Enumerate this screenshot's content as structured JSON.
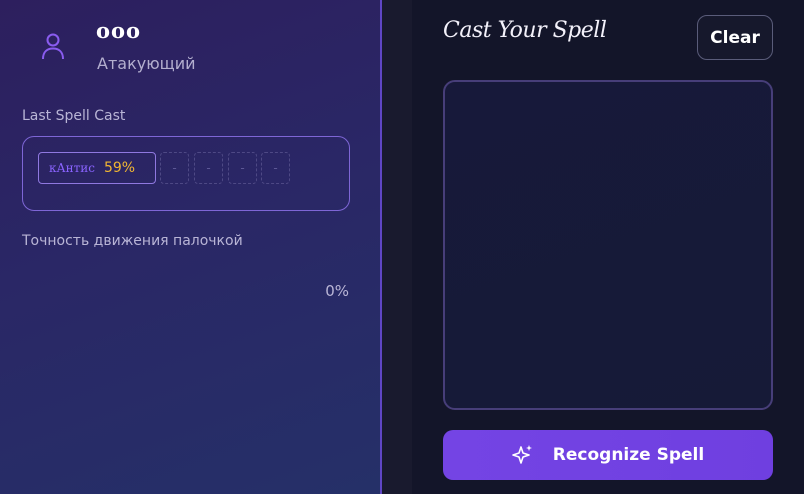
{
  "profile": {
    "name": "ooo",
    "role": "Атакующий",
    "icon": "user-icon"
  },
  "last_spell": {
    "label": "Last Spell Cast",
    "spell_name": "кАнтис",
    "confidence": "59%",
    "empty_slots": [
      "-",
      "-",
      "-",
      "-"
    ]
  },
  "accuracy": {
    "label": "Точность движения палочкой",
    "value": "0%"
  },
  "canvas_panel": {
    "title": "Cast Your Spell",
    "clear_label": "Clear",
    "recognize_label": "Recognize Spell",
    "recognize_icon": "sparkle-icon"
  },
  "colors": {
    "accent": "#7444e4",
    "confidence": "#f2b632",
    "spell_name": "#8a63ff"
  }
}
